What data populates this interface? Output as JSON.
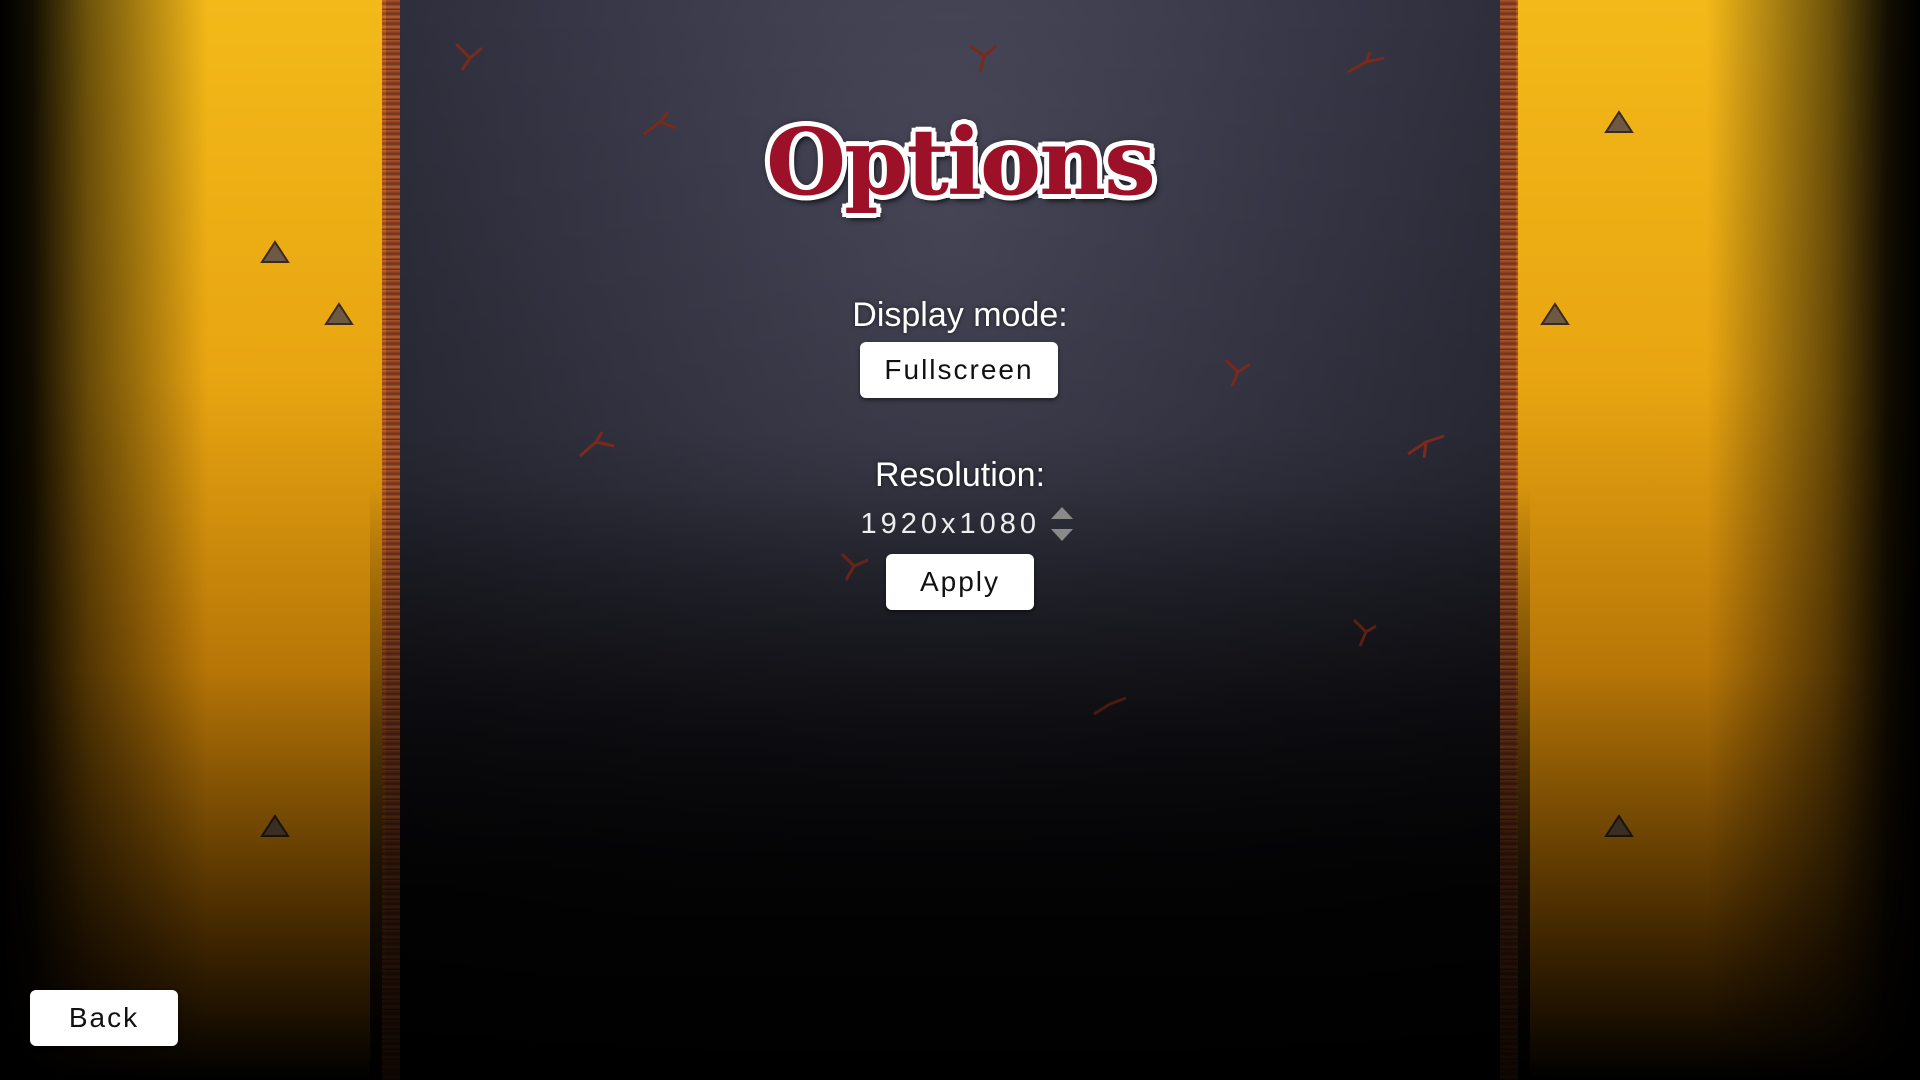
{
  "screen": {
    "title": "Options"
  },
  "display_mode": {
    "label": "Display mode:",
    "value": "Fullscreen"
  },
  "resolution": {
    "label": "Resolution:",
    "value": "1920x1080",
    "apply_label": "Apply"
  },
  "navigation": {
    "back_label": "Back"
  },
  "colors": {
    "title_red": "#9c1028",
    "wall_gold": "#f3b919",
    "floor": "#383848",
    "button_bg": "#ffffff"
  }
}
